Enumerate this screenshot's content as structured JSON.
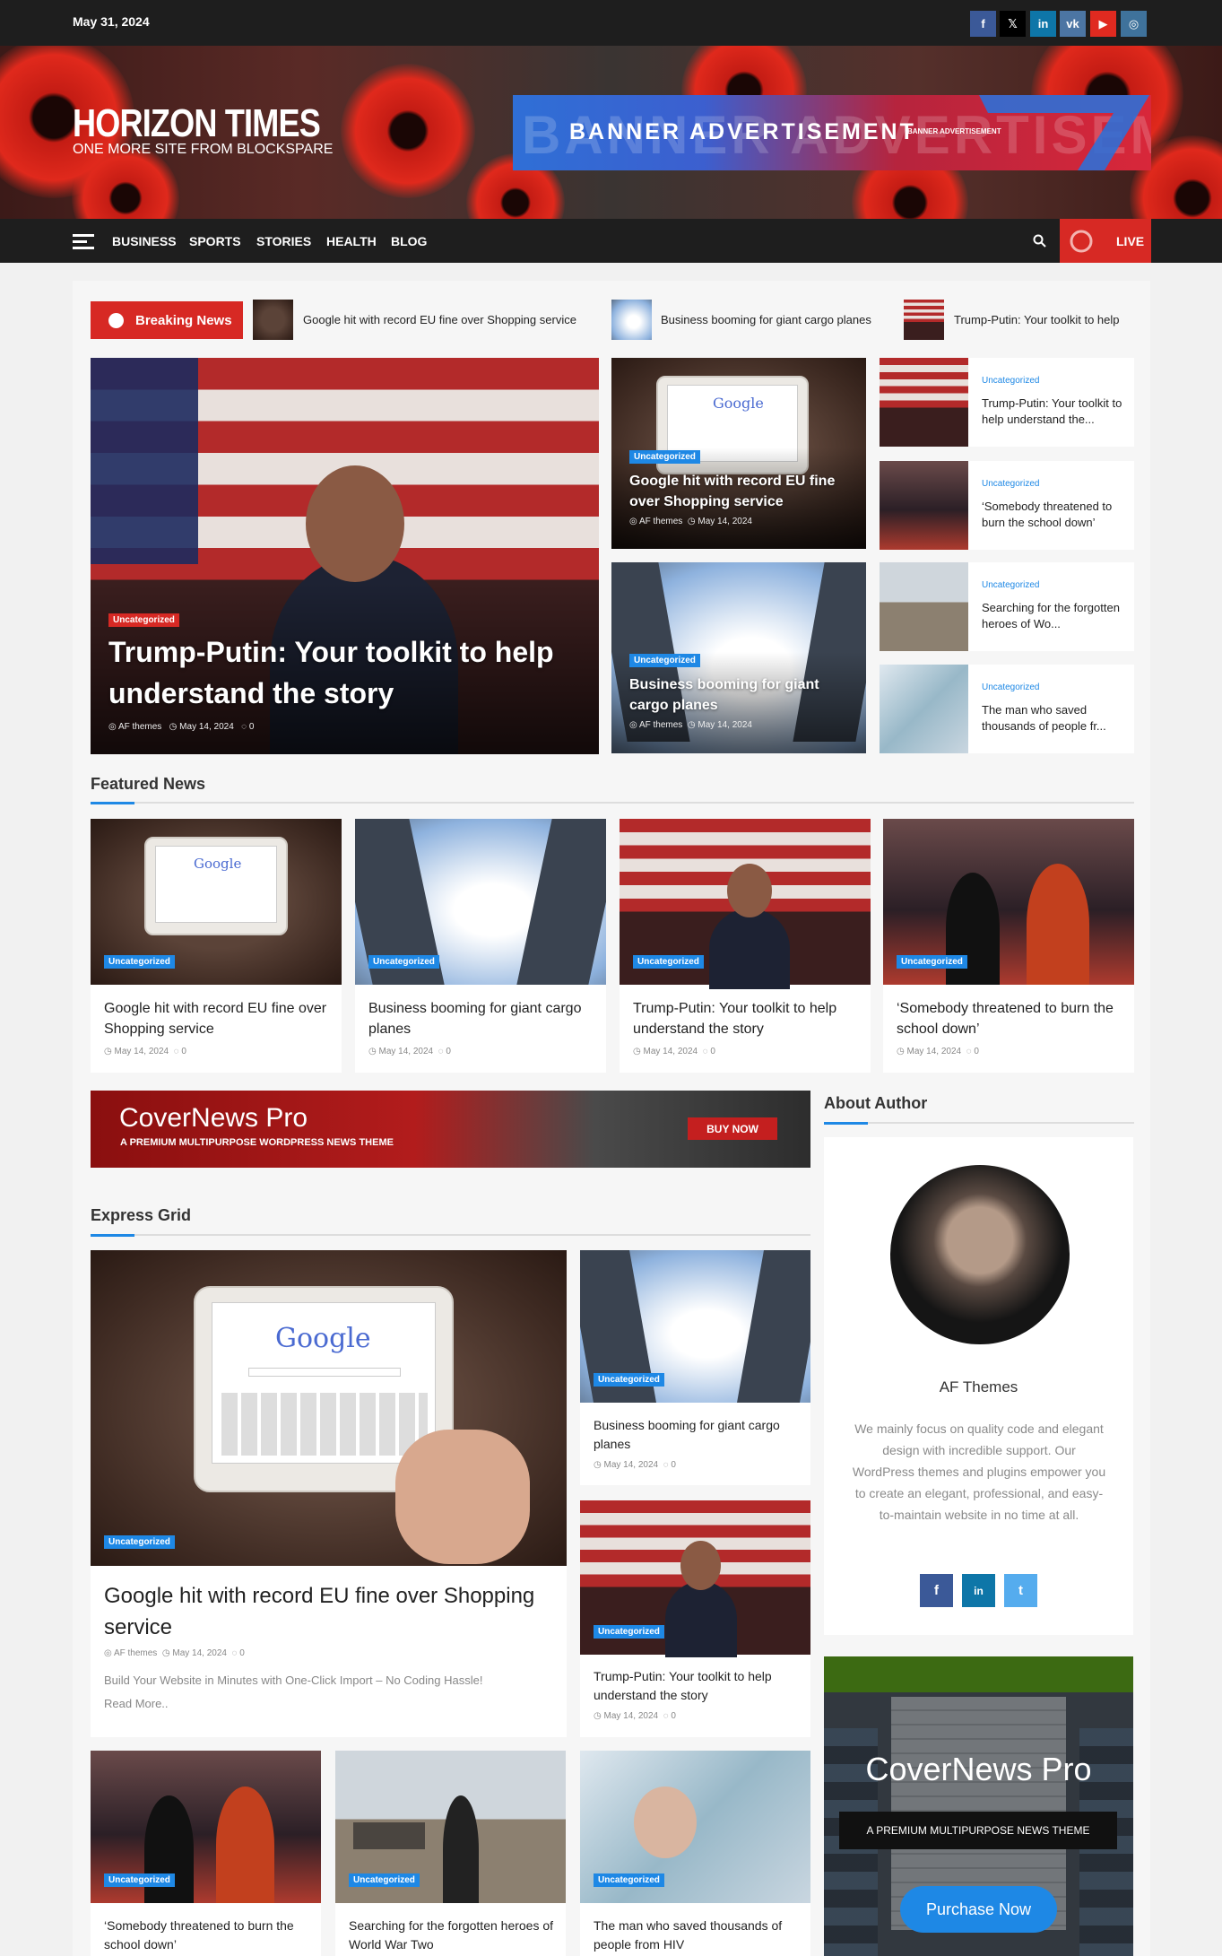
{
  "topbar": {
    "date": "May 31, 2024",
    "social": [
      {
        "icon": "facebook-icon",
        "glyph": "f",
        "color": "#3b5998"
      },
      {
        "icon": "x-icon",
        "glyph": "𝕏",
        "color": "#000000"
      },
      {
        "icon": "linkedin-icon",
        "glyph": "in",
        "color": "#0e76a8"
      },
      {
        "icon": "vk-icon",
        "glyph": "vk",
        "color": "#4c75a3"
      },
      {
        "icon": "youtube-icon",
        "glyph": "▶",
        "color": "#e02a20"
      },
      {
        "icon": "instagram-icon",
        "glyph": "◎",
        "color": "#3f729b"
      }
    ]
  },
  "header": {
    "site_title": "HORIZON TIMES",
    "tagline": "ONE MORE SITE FROM BLOCKSPARE",
    "banner_text": "BANNER ADVERTISEMENT",
    "banner_ghost": "BANNER ADVERTISEME",
    "banner_small": "BANNER ADVERTISEMENT"
  },
  "nav": {
    "items": [
      "BUSINESS",
      "SPORTS",
      "STORIES",
      "HEALTH",
      "BLOG"
    ],
    "live_label": "LIVE"
  },
  "ticker": {
    "label": "Breaking News",
    "items": [
      "Google hit with record EU fine over Shopping service",
      "Business booming for giant cargo planes",
      "Trump-Putin: Your toolkit to help"
    ]
  },
  "colors": {
    "accent": "#1e88e5",
    "brand_red": "#d72924",
    "dark": "#1e1e1e"
  },
  "hero": {
    "badge": "Uncategorized",
    "title": "Trump-Putin: Your toolkit to help understand the story",
    "author": "AF themes",
    "date": "May 14, 2024",
    "comments": "0"
  },
  "mid_cards": [
    {
      "badge": "Uncategorized",
      "title": "Google hit with record EU fine over Shopping service",
      "author": "AF themes",
      "date": "May 14, 2024"
    },
    {
      "badge": "Uncategorized",
      "title": "Business booming for giant cargo planes",
      "author": "AF themes",
      "date": "May 14, 2024"
    }
  ],
  "side_list": [
    {
      "category": "Uncategorized",
      "title": "Trump-Putin: Your toolkit to help understand the..."
    },
    {
      "category": "Uncategorized",
      "title": "‘Somebody threatened to burn the school down’"
    },
    {
      "category": "Uncategorized",
      "title": "Searching for the forgotten heroes of Wo..."
    },
    {
      "category": "Uncategorized",
      "title": "The man who saved thousands of people fr..."
    }
  ],
  "featured": {
    "heading": "Featured News",
    "items": [
      {
        "badge": "Uncategorized",
        "title": "Google hit with record EU fine over Shopping service",
        "date": "May 14, 2024",
        "comments": "0"
      },
      {
        "badge": "Uncategorized",
        "title": "Business booming for giant cargo planes",
        "date": "May 14, 2024",
        "comments": "0"
      },
      {
        "badge": "Uncategorized",
        "title": "Trump-Putin: Your toolkit to help understand the story",
        "date": "May 14, 2024",
        "comments": "0"
      },
      {
        "badge": "Uncategorized",
        "title": "‘Somebody threatened to burn the school down’",
        "date": "May 14, 2024",
        "comments": "0"
      }
    ]
  },
  "ad_strip": {
    "title": "CoverNews Pro",
    "subtitle": "A PREMIUM MULTIPURPOSE WORDPRESS NEWS THEME",
    "button": "BUY NOW"
  },
  "express": {
    "heading": "Express Grid",
    "main": {
      "badge": "Uncategorized",
      "title": "Google hit with record EU fine over Shopping service",
      "author": "AF themes",
      "date": "May 14, 2024",
      "comments": "0",
      "excerpt": "Build Your Website in Minutes with One-Click Import – No Coding Hassle!",
      "read_more": "Read More.."
    },
    "side": [
      {
        "badge": "Uncategorized",
        "title": "Business booming for giant cargo planes",
        "date": "May 14, 2024",
        "comments": "0"
      },
      {
        "badge": "Uncategorized",
        "title": "Trump-Putin: Your toolkit to help understand the story",
        "date": "May 14, 2024",
        "comments": "0"
      }
    ],
    "bottom": [
      {
        "badge": "Uncategorized",
        "title": "‘Somebody threatened to burn the school down’"
      },
      {
        "badge": "Uncategorized",
        "title": "Searching for the forgotten heroes of World War Two"
      },
      {
        "badge": "Uncategorized",
        "title": "The man who saved thousands of people from HIV"
      }
    ]
  },
  "author": {
    "heading": "About Author",
    "name": "AF Themes",
    "bio": "We mainly focus on quality code and elegant design with incredible support. Our WordPress themes and plugins empower you to create an elegant, professional, and easy-to-maintain website in no time at all.",
    "social": [
      {
        "icon": "facebook-icon",
        "glyph": "f",
        "color": "#3b5998"
      },
      {
        "icon": "linkedin-icon",
        "glyph": "in",
        "color": "#0e76a8"
      },
      {
        "icon": "twitter-icon",
        "glyph": "t",
        "color": "#55acee"
      }
    ]
  },
  "promo": {
    "title": "CoverNews Pro",
    "subtitle": "A PREMIUM MULTIPURPOSE NEWS THEME",
    "button": "Purchase Now"
  }
}
